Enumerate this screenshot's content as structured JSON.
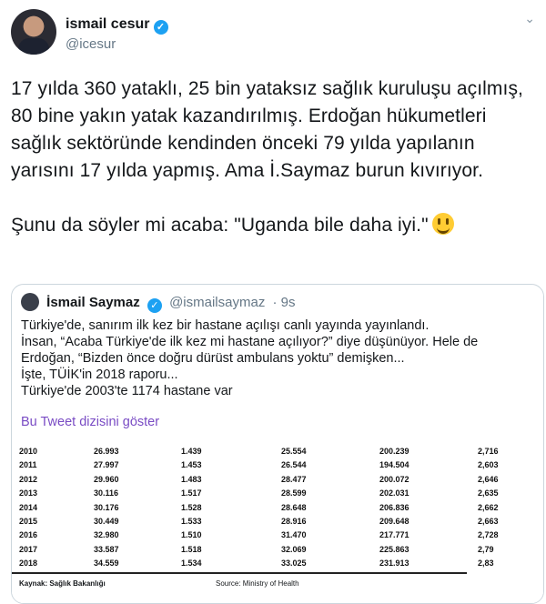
{
  "author": {
    "name": "ismail cesur",
    "handle": "@icesur"
  },
  "tweet_text": "17 yılda 360 yataklı, 25 bin yataksız sağlık kuruluşu açılmış, 80 bine yakın yatak kazandırılmış. Erdoğan hükumetleri sağlık sektöründe kendinden önceki 79 yılda yapılanın yarısını 17 yılda yapmış. Ama İ.Saymaz burun kıvırıyor.\n\nŞunu da söyler mi acaba: \"Uganda bile daha iyi.\"",
  "quoted": {
    "name": "İsmail Saymaz",
    "handle": "@ismailsaymaz",
    "time": "· 9s",
    "text": "Türkiye'de, sanırım ilk kez bir hastane açılışı canlı yayında yayınlandı.\nİnsan, “Acaba Türkiye'de ilk kez mi hastane açılıyor?” diye düşünüyor. Hele de Erdoğan, “Bizden önce doğru dürüst ambulans yoktu” demişken...\nİşte, TÜİK'in 2018 raporu...\nTürkiye'de 2003'te 1174 hastane var",
    "show_thread": "Bu Tweet dizisini göster"
  },
  "table": {
    "rows": [
      [
        "2010",
        "26.993",
        "1.439",
        "25.554",
        "200.239",
        "2,716"
      ],
      [
        "2011",
        "27.997",
        "1.453",
        "26.544",
        "194.504",
        "2,603"
      ],
      [
        "2012",
        "29.960",
        "1.483",
        "28.477",
        "200.072",
        "2,646"
      ],
      [
        "2013",
        "30.116",
        "1.517",
        "28.599",
        "202.031",
        "2,635"
      ],
      [
        "2014",
        "30.176",
        "1.528",
        "28.648",
        "206.836",
        "2,662"
      ],
      [
        "2015",
        "30.449",
        "1.533",
        "28.916",
        "209.648",
        "2,663"
      ],
      [
        "2016",
        "32.980",
        "1.510",
        "31.470",
        "217.771",
        "2,728"
      ],
      [
        "2017",
        "33.587",
        "1.518",
        "32.069",
        "225.863",
        "2,79"
      ],
      [
        "2018",
        "34.559",
        "1.534",
        "33.025",
        "231.913",
        "2,83"
      ]
    ],
    "source_tr": "Kaynak: Sağlık Bakanlığı",
    "source_en": "Source: Ministry of Health"
  },
  "icons": {
    "verified": "verified-badge-icon",
    "menu": "chevron-down-icon",
    "emoji": "grinning-face-icon"
  },
  "colors": {
    "link": "#794bc4",
    "verified": "#1da1f2",
    "muted": "#657786"
  }
}
